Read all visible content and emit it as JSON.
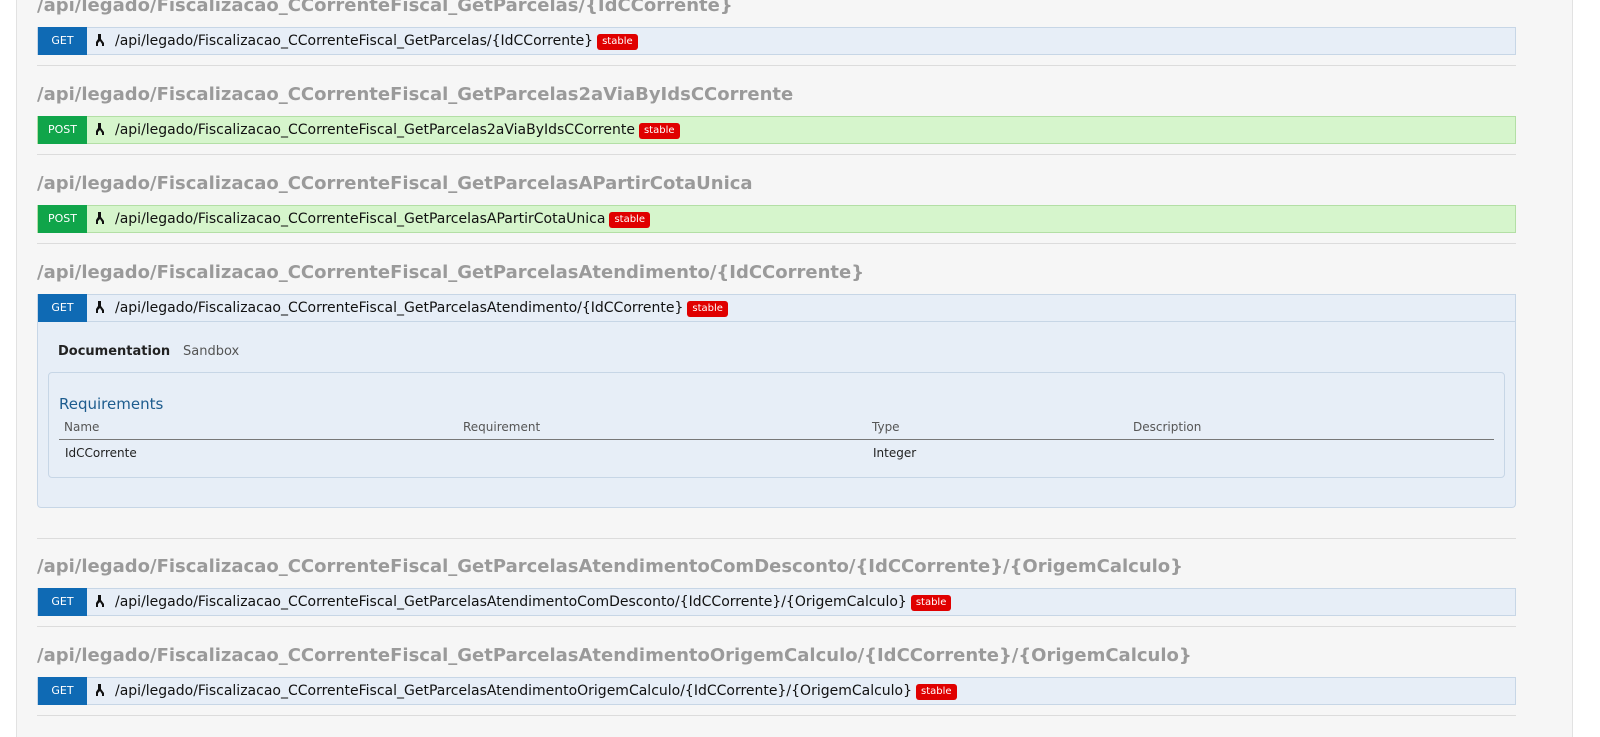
{
  "sections": [
    {
      "title": "/api/legado/Fiscalizacao_CCorrenteFiscal_GetParcelas/{IdCCorrente}",
      "method": "GET",
      "path": "/api/legado/Fiscalizacao_CCorrenteFiscal_GetParcelas/{IdCCorrente}",
      "badge": "stable"
    },
    {
      "title": "/api/legado/Fiscalizacao_CCorrenteFiscal_GetParcelas2aViaByIdsCCorrente",
      "method": "POST",
      "path": "/api/legado/Fiscalizacao_CCorrenteFiscal_GetParcelas2aViaByIdsCCorrente",
      "badge": "stable"
    },
    {
      "title": "/api/legado/Fiscalizacao_CCorrenteFiscal_GetParcelasAPartirCotaUnica",
      "method": "POST",
      "path": "/api/legado/Fiscalizacao_CCorrenteFiscal_GetParcelasAPartirCotaUnica",
      "badge": "stable"
    },
    {
      "title": "/api/legado/Fiscalizacao_CCorrenteFiscal_GetParcelasAtendimento/{IdCCorrente}",
      "method": "GET",
      "path": "/api/legado/Fiscalizacao_CCorrenteFiscal_GetParcelasAtendimento/{IdCCorrente}",
      "badge": "stable",
      "details": {
        "tabs": [
          "Documentation",
          "Sandbox"
        ],
        "requirements_title": "Requirements",
        "columns": [
          "Name",
          "Requirement",
          "Type",
          "Description"
        ],
        "rows": [
          {
            "name": "IdCCorrente",
            "requirement": "",
            "type": "Integer",
            "description": ""
          }
        ]
      }
    },
    {
      "title": "/api/legado/Fiscalizacao_CCorrenteFiscal_GetParcelasAtendimentoComDesconto/{IdCCorrente}/{OrigemCalculo}",
      "method": "GET",
      "path": "/api/legado/Fiscalizacao_CCorrenteFiscal_GetParcelasAtendimentoComDesconto/{IdCCorrente}/{OrigemCalculo}",
      "badge": "stable"
    },
    {
      "title": "/api/legado/Fiscalizacao_CCorrenteFiscal_GetParcelasAtendimentoOrigemCalculo/{IdCCorrente}/{OrigemCalculo}",
      "method": "GET",
      "path": "/api/legado/Fiscalizacao_CCorrenteFiscal_GetParcelasAtendimentoOrigemCalculo/{IdCCorrente}/{OrigemCalculo}",
      "badge": "stable"
    }
  ],
  "colors": {
    "get": "#0f6ab4",
    "post": "#10a54a",
    "badge": "#e00000",
    "title_gray": "#9a9a9a"
  },
  "icons": {
    "endpoint_icon": "key-icon"
  }
}
